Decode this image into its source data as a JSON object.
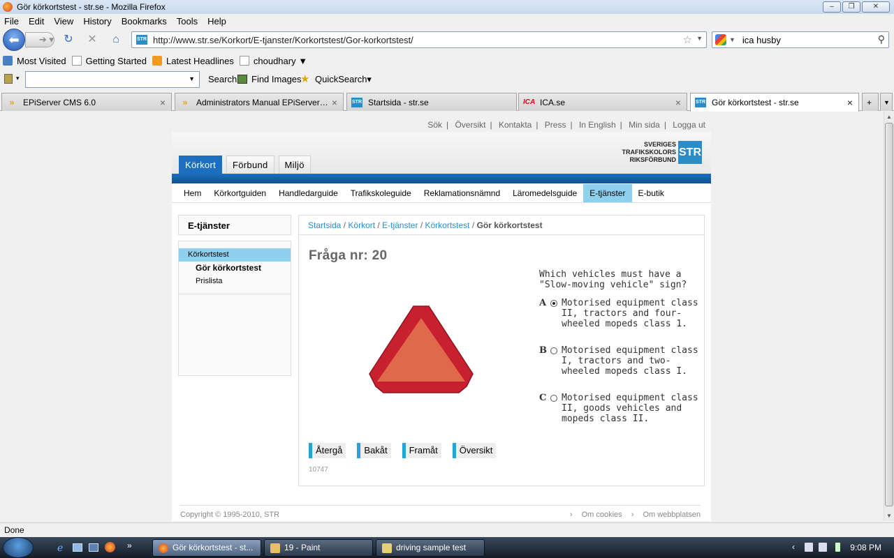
{
  "window": {
    "title": "Gör körkortstest - str.se - Mozilla Firefox"
  },
  "menu": [
    "File",
    "Edit",
    "View",
    "History",
    "Bookmarks",
    "Tools",
    "Help"
  ],
  "nav": {
    "url": "http://www.str.se/Korkort/E-tjanster/Korkortstest/Gor-korkortstest/",
    "search_value": "ica husby",
    "site_badge": "STR"
  },
  "bookmarks": [
    "Most Visited",
    "Getting Started",
    "Latest Headlines",
    "choudhary ▼"
  ],
  "toolbar2": {
    "search": "Search",
    "find_images": "Find Images",
    "quicksearch": "QuickSearch▾"
  },
  "tabs": [
    {
      "label": "EPiServer CMS 6.0",
      "icon": "episerver-icon"
    },
    {
      "label": "Administrators Manual EPiServer C...",
      "icon": "episerver-icon"
    },
    {
      "label": "Startsida - str.se",
      "icon": "str-icon"
    },
    {
      "label": "ICA.se",
      "icon": "ica-icon"
    },
    {
      "label": "Gör körkortstest - str.se",
      "icon": "str-icon"
    }
  ],
  "site": {
    "toplinks": [
      "Sök",
      "Översikt",
      "Kontakta",
      "Press",
      "In English",
      "Min sida",
      "Logga ut"
    ],
    "toplink_sep": "|",
    "logo": {
      "line1": "SVERIGES",
      "line2": "TRAFIKSKOLORS",
      "line3": "RIKSFÖRBUND",
      "badge": "STR"
    },
    "main_tabs": [
      "Körkort",
      "Förbund",
      "Miljö"
    ],
    "subnav": [
      "Hem",
      "Körkortguiden",
      "Handledarguide",
      "Trafikskoleguide",
      "Reklamationsnämnd",
      "Läromedelsguide",
      "E-tjänster",
      "E-butik"
    ],
    "left": {
      "title": "E-tjänster",
      "items": [
        "Körkortstest",
        "Gör körkortstest",
        "Prislista"
      ]
    },
    "breadcrumb": {
      "items": [
        "Startsida",
        "Körkort",
        "E-tjänster",
        "Körkortstest"
      ],
      "current": "Gör körkortstest",
      "sep": "/"
    },
    "question_title": "Fråga nr: 20",
    "question": "Which vehicles must have a \"Slow-moving vehicle\" sign?",
    "options": [
      {
        "letter": "A",
        "text": "Motorised equipment class II, tractors and four-wheeled mopeds class 1.",
        "selected": true
      },
      {
        "letter": "B",
        "text": "Motorised equipment class I, tractors and two-wheeled mopeds class I.",
        "selected": false
      },
      {
        "letter": "C",
        "text": "Motorised equipment class II, goods vehicles and mopeds class II.",
        "selected": false
      }
    ],
    "buttons": [
      "Återgå",
      "Bakåt",
      "Framåt",
      "Översikt"
    ],
    "code": "10747",
    "footer": {
      "copyright": "Copyright © 1995-2010, STR",
      "links": [
        "Om cookies",
        "Om webbplatsen"
      ]
    }
  },
  "status": "Done",
  "taskbar": {
    "tasks": [
      "Gör körkortstest - st...",
      "19 - Paint",
      "driving sample test"
    ],
    "clock": "9:08 PM"
  },
  "colors": {
    "accent": "#1c6fbf",
    "subnav_active": "#8fd0ee",
    "link": "#2b8dc8",
    "sign_outer": "#c8202f",
    "sign_inner": "#e0694c"
  }
}
